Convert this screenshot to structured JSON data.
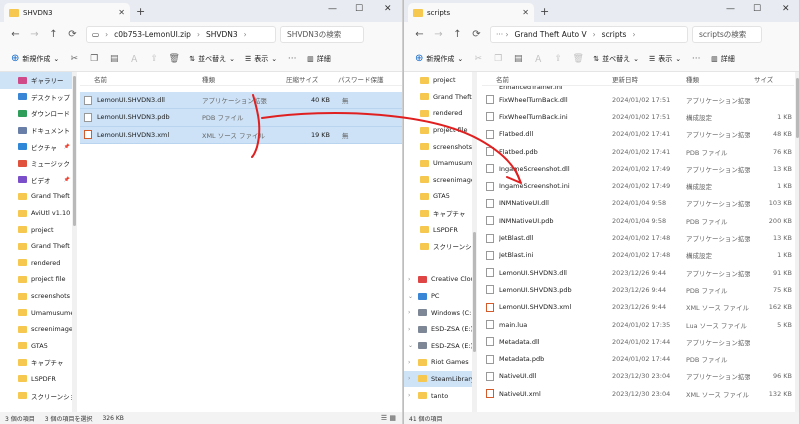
{
  "left": {
    "tab_title": "SHVDN3",
    "address": [
      "c0b753-LemonUI.zip",
      "SHVDN3"
    ],
    "search_placeholder": "SHVDN3の検索",
    "cmd": {
      "new": "新規作成",
      "sort": "並べ替え",
      "view": "表示",
      "detail": "詳細"
    },
    "nav": [
      {
        "label": "ギャラリー",
        "type": "gallery",
        "sel": true
      },
      {
        "label": "デスクトップ",
        "type": "desktop"
      },
      {
        "label": "ダウンロード",
        "type": "download"
      },
      {
        "label": "ドキュメント",
        "type": "documents"
      },
      {
        "label": "ピクチャ",
        "type": "pictures"
      },
      {
        "label": "ミュージック",
        "type": "music"
      },
      {
        "label": "ビデオ",
        "type": "video"
      },
      {
        "label": "Grand Theft",
        "type": "folder"
      },
      {
        "label": "AviUtl v1.10",
        "type": "folder"
      },
      {
        "label": "project",
        "type": "folder"
      },
      {
        "label": "Grand Theft",
        "type": "folder"
      },
      {
        "label": "rendered",
        "type": "folder"
      },
      {
        "label": "project file",
        "type": "folder"
      },
      {
        "label": "screenshots",
        "type": "folder"
      },
      {
        "label": "Umamusume",
        "type": "folder"
      },
      {
        "label": "screenimage",
        "type": "folder"
      },
      {
        "label": "GTA5",
        "type": "folder"
      },
      {
        "label": "キャプチャ",
        "type": "folder"
      },
      {
        "label": "LSPDFR",
        "type": "folder"
      },
      {
        "label": "スクリーンショット",
        "type": "folder"
      }
    ],
    "columns": {
      "name": "名前",
      "type": "種類",
      "compressed": "圧縮サイズ",
      "password": "パスワード保護"
    },
    "files": [
      {
        "name": "LemonUI.SHVDN3.dll",
        "type": "アプリケーション拡張",
        "size": "40 KB",
        "pw": "無",
        "icon": "dll"
      },
      {
        "name": "LemonUI.SHVDN3.pdb",
        "type": "PDB ファイル",
        "size": "",
        "pw": "",
        "icon": "pdb"
      },
      {
        "name": "LemonUI.SHVDN3.xml",
        "type": "XML ソース ファイル",
        "size": "19 KB",
        "pw": "無",
        "icon": "xml"
      }
    ],
    "status": [
      "3 個の項目",
      "3 個の項目を選択",
      "326 KB"
    ]
  },
  "right": {
    "tab_title": "scripts",
    "address": [
      "Grand Theft Auto V",
      "scripts"
    ],
    "search_placeholder": "scriptsの検索",
    "cmd": {
      "new": "新規作成",
      "sort": "並べ替え",
      "view": "表示",
      "detail": "詳細"
    },
    "nav": [
      {
        "label": "project",
        "type": "folder"
      },
      {
        "label": "Grand Theft",
        "type": "folder"
      },
      {
        "label": "rendered",
        "type": "folder"
      },
      {
        "label": "project file",
        "type": "folder"
      },
      {
        "label": "screenshots",
        "type": "folder"
      },
      {
        "label": "Umamusume",
        "type": "folder"
      },
      {
        "label": "screenimage",
        "type": "folder"
      },
      {
        "label": "GTA5",
        "type": "folder"
      },
      {
        "label": "キャプチャ",
        "type": "folder"
      },
      {
        "label": "LSPDFR",
        "type": "folder"
      },
      {
        "label": "スクリーンショット",
        "type": "folder"
      },
      {
        "label": "",
        "type": "blank"
      },
      {
        "label": "Creative Cloud",
        "type": "cloud",
        "chev": "›"
      },
      {
        "label": "PC",
        "type": "pc",
        "chev": "⌄"
      },
      {
        "label": "Windows (C:)",
        "type": "drive",
        "chev": "›"
      },
      {
        "label": "ESD-ZSA (E:)",
        "type": "drive",
        "chev": "›"
      },
      {
        "label": "ESD-ZSA (E:)",
        "type": "drive",
        "chev": "⌄"
      },
      {
        "label": "Riot Games",
        "type": "folder",
        "chev": "›"
      },
      {
        "label": "SteamLibrary",
        "type": "folder",
        "chev": "›",
        "sel": true
      },
      {
        "label": "tanto",
        "type": "folder",
        "chev": "›"
      }
    ],
    "columns": {
      "name": "名前",
      "date": "更新日時",
      "type": "種類",
      "size": "サイズ"
    },
    "partial_row": "EnhancedTrainer.ini",
    "files": [
      {
        "name": "FixWheelTurnBack.dll",
        "date": "2024/01/02 17:51",
        "type": "アプリケーション拡張",
        "size": "",
        "icon": "dll"
      },
      {
        "name": "FixWheelTurnBack.ini",
        "date": "2024/01/02 17:51",
        "type": "構成設定",
        "size": "1 KB",
        "icon": "ini"
      },
      {
        "name": "Flatbed.dll",
        "date": "2024/01/02 17:41",
        "type": "アプリケーション拡張",
        "size": "48 KB",
        "icon": "dll"
      },
      {
        "name": "Flatbed.pdb",
        "date": "2024/01/02 17:41",
        "type": "PDB ファイル",
        "size": "76 KB",
        "icon": "pdb"
      },
      {
        "name": "IngameScreenshot.dll",
        "date": "2024/01/02 17:49",
        "type": "アプリケーション拡張",
        "size": "13 KB",
        "icon": "dll"
      },
      {
        "name": "IngameScreenshot.ini",
        "date": "2024/01/02 17:49",
        "type": "構成設定",
        "size": "1 KB",
        "icon": "ini"
      },
      {
        "name": "INMNativeUI.dll",
        "date": "2024/01/04 9:58",
        "type": "アプリケーション拡張",
        "size": "103 KB",
        "icon": "dll"
      },
      {
        "name": "INMNativeUI.pdb",
        "date": "2024/01/04 9:58",
        "type": "PDB ファイル",
        "size": "200 KB",
        "icon": "pdb"
      },
      {
        "name": "JetBlast.dll",
        "date": "2024/01/02 17:48",
        "type": "アプリケーション拡張",
        "size": "13 KB",
        "icon": "dll"
      },
      {
        "name": "JetBlast.ini",
        "date": "2024/01/02 17:48",
        "type": "構成設定",
        "size": "1 KB",
        "icon": "ini"
      },
      {
        "name": "LemonUI.SHVDN3.dll",
        "date": "2023/12/26 9:44",
        "type": "アプリケーション拡張",
        "size": "91 KB",
        "icon": "dll"
      },
      {
        "name": "LemonUI.SHVDN3.pdb",
        "date": "2023/12/26 9:44",
        "type": "PDB ファイル",
        "size": "75 KB",
        "icon": "pdb"
      },
      {
        "name": "LemonUI.SHVDN3.xml",
        "date": "2023/12/26 9:44",
        "type": "XML ソース ファイル",
        "size": "162 KB",
        "icon": "xml"
      },
      {
        "name": "main.lua",
        "date": "2024/01/02 17:35",
        "type": "Lua ソース ファイル",
        "size": "5 KB",
        "icon": "lua"
      },
      {
        "name": "Metadata.dll",
        "date": "2024/01/02 17:44",
        "type": "アプリケーション拡張",
        "size": "",
        "icon": "dll"
      },
      {
        "name": "Metadata.pdb",
        "date": "2024/01/02 17:44",
        "type": "PDB ファイル",
        "size": "",
        "icon": "pdb"
      },
      {
        "name": "NativeUI.dll",
        "date": "2023/12/30 23:04",
        "type": "アプリケーション拡張",
        "size": "96 KB",
        "icon": "dll"
      },
      {
        "name": "NativeUI.xml",
        "date": "2023/12/30 23:04",
        "type": "XML ソース ファイル",
        "size": "132 KB",
        "icon": "xml"
      }
    ],
    "status": [
      "41 個の項目"
    ]
  },
  "colors": {
    "accent": "#0a64c8",
    "selection": "#cde2f6",
    "folder": "#f6c84f",
    "annotation": "#e02020"
  }
}
